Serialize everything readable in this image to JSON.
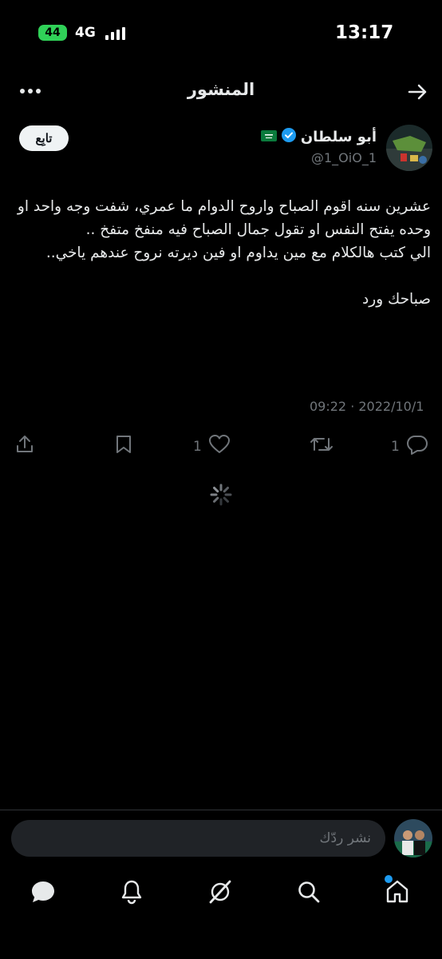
{
  "status_bar": {
    "time": "13:17",
    "battery": "44",
    "network": "4G"
  },
  "header": {
    "title": "المنشور"
  },
  "author": {
    "name": "أبو سلطان",
    "flag": "🇸🇦",
    "handle": "@1_OiO_1",
    "follow_label": "تابِع"
  },
  "post": {
    "text": "عشرين سنه اقوم الصباح واروح الدوام ما عمري، شفت وجه واحد او وحده يفتح النفس او تقول جمال الصباح فيه منفخ متفخ ..\nالي كتب هالكلام مع مين يداوم او فين ديرته نروح عندهم ياخي..\n\nصباحك ورد",
    "date": "09:22 · 2022/10/1"
  },
  "actions": {
    "reply_count": "1",
    "like_count": "1",
    "retweet_count": ""
  },
  "reply_bar": {
    "placeholder": "نشر ردّك"
  },
  "colors": {
    "background": "#000000",
    "accent": "#1d9bf0",
    "muted": "#71767b",
    "text": "#e7e9ea"
  },
  "icons": [
    "share-icon",
    "bookmark-icon",
    "heart-icon",
    "retweet-icon",
    "reply-icon",
    "chat-icon",
    "bell-icon",
    "grok-icon",
    "search-icon",
    "home-icon"
  ]
}
